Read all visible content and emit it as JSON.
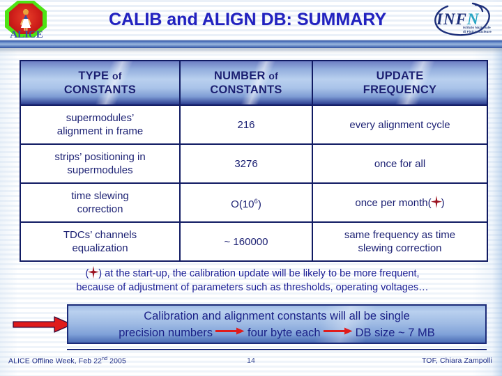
{
  "slide": {
    "title": "CALIB and ALIGN DB: SUMMARY"
  },
  "logos": {
    "alice": {
      "name": "alice-logo",
      "wordmark": "ALICE"
    },
    "infn": {
      "name": "infn-logo",
      "acronym_part1": "INF",
      "acronym_part2": "N",
      "subtitle_line1": "Istituto Nazionale",
      "subtitle_line2": "di Fisica Nucleare"
    }
  },
  "table": {
    "headers": [
      {
        "line1": "TYPE",
        "small": "of",
        "line2": "CONSTANTS"
      },
      {
        "line1": "NUMBER",
        "small": "of",
        "line2": "CONSTANTS"
      },
      {
        "line1": "UPDATE",
        "small": "",
        "line2": "FREQUENCY"
      }
    ],
    "rows": [
      {
        "type_line1": "supermodules’",
        "type_line2": "alignment in frame",
        "number": "216",
        "number_exp": "",
        "frequency_line1": "every alignment cycle",
        "frequency_line2": "",
        "has_sparkle": false
      },
      {
        "type_line1": "strips’ positioning in",
        "type_line2": "supermodules",
        "number": "3276",
        "number_exp": "",
        "frequency_line1": "once for all",
        "frequency_line2": "",
        "has_sparkle": false
      },
      {
        "type_line1": "time slewing",
        "type_line2": "correction",
        "number": "O(10",
        "number_exp": "6",
        "number_suffix": ")",
        "frequency_line1": "once per month(",
        "frequency_line2": ")",
        "has_sparkle": true
      },
      {
        "type_line1": "TDCs’ channels",
        "type_line2": "equalization",
        "number": "~ 160000",
        "number_exp": "",
        "frequency_line1": "same frequency as time",
        "frequency_line2": "slewing correction",
        "has_sparkle": false
      }
    ]
  },
  "footnote": {
    "prefix_open": "(",
    "prefix_close": ")",
    "line1": " at the start-up, the calibration update will be likely to be more frequent,",
    "line2": "because of adjustment of parameters such as thresholds, operating voltages…"
  },
  "callout": {
    "line1": "Calibration and alignment constants will all be single",
    "line2_part1": "precision numbers",
    "line2_part2": "four byte each",
    "line2_part3": "DB size ~ 7 MB"
  },
  "footer": {
    "left_text": "ALICE Offline Week, Feb 22",
    "left_sup": "nd",
    "left_year": " 2005",
    "page_number": "14",
    "right_text": "TOF, Chiara Zampolli"
  },
  "colors": {
    "title_blue": "#2222c0",
    "navy": "#1a1f72",
    "header_gradient_light": "#b9d0ef",
    "header_gradient_dark": "#2b3d90",
    "accent_red": "#d81616",
    "sparkle_red": "#9b1320"
  }
}
